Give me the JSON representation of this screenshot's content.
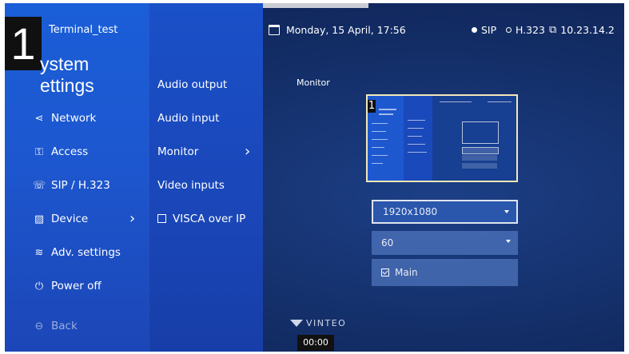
{
  "badge": "1",
  "terminal_name": "Terminal_test",
  "sidebar": {
    "title_line1": "ystem",
    "title_line2": "ettings",
    "items": [
      {
        "label": "Network",
        "icon": "share-icon"
      },
      {
        "label": "Access",
        "icon": "access-icon"
      },
      {
        "label": "SIP / H.323",
        "icon": "phone-icon"
      },
      {
        "label": "Device",
        "icon": "device-icon"
      },
      {
        "label": "Adv. settings",
        "icon": "sliders-icon"
      },
      {
        "label": "Power off",
        "icon": "power-icon"
      }
    ],
    "back": "Back"
  },
  "submenu": {
    "items": [
      "Audio output",
      "Audio input",
      "Monitor",
      "Video inputs"
    ],
    "visca": "VISCA over IP"
  },
  "topbar": {
    "datetime": "Monday, 15 April, 17:56",
    "sip": "SIP",
    "h323": "H.323",
    "ip": "10.23.14.2",
    "colors": {
      "active": "#ffffff",
      "inactive": "#ffffff"
    }
  },
  "monitor": {
    "label": "Monitor",
    "resolution": "1920x1080",
    "refresh": "60",
    "main_label": "Main",
    "main_checked": true
  },
  "preview": {
    "badge": "1"
  },
  "footer": {
    "logo": "VINTEO",
    "time": "00:00"
  }
}
